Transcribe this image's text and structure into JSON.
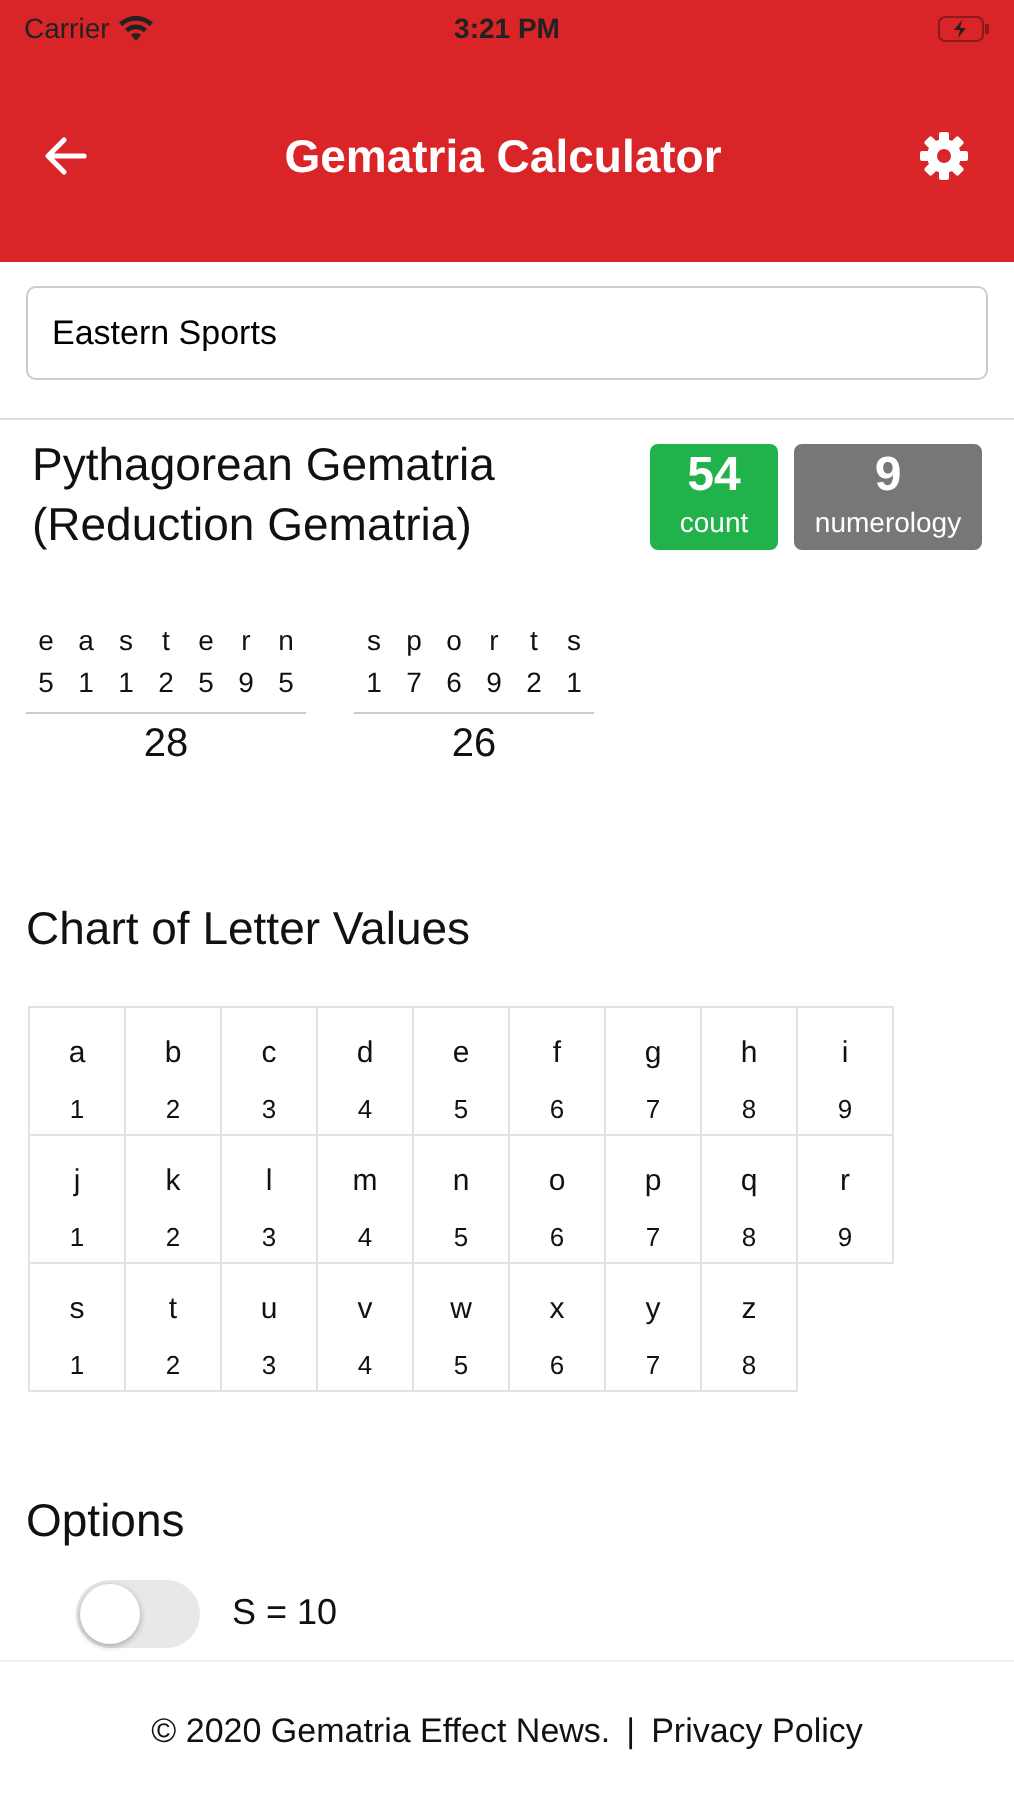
{
  "status_bar": {
    "carrier": "Carrier",
    "time": "3:21 PM",
    "battery_charging": true
  },
  "header": {
    "title": "Gematria Calculator"
  },
  "search": {
    "value": "Eastern Sports"
  },
  "result": {
    "title": "Pythagorean Gematria (Reduction Gematria)",
    "count": "54",
    "count_label": "count",
    "numerology": "9",
    "numerology_label": "numerology"
  },
  "words": [
    {
      "letters": [
        "e",
        "a",
        "s",
        "t",
        "e",
        "r",
        "n"
      ],
      "values": [
        "5",
        "1",
        "1",
        "2",
        "5",
        "9",
        "5"
      ],
      "total": "28"
    },
    {
      "letters": [
        "s",
        "p",
        "o",
        "r",
        "t",
        "s"
      ],
      "values": [
        "1",
        "7",
        "6",
        "9",
        "2",
        "1"
      ],
      "total": "26"
    }
  ],
  "chart": {
    "title": "Chart of Letter Values",
    "cells": [
      {
        "letter": "a",
        "value": "1"
      },
      {
        "letter": "b",
        "value": "2"
      },
      {
        "letter": "c",
        "value": "3"
      },
      {
        "letter": "d",
        "value": "4"
      },
      {
        "letter": "e",
        "value": "5"
      },
      {
        "letter": "f",
        "value": "6"
      },
      {
        "letter": "g",
        "value": "7"
      },
      {
        "letter": "h",
        "value": "8"
      },
      {
        "letter": "i",
        "value": "9"
      },
      {
        "letter": "j",
        "value": "1"
      },
      {
        "letter": "k",
        "value": "2"
      },
      {
        "letter": "l",
        "value": "3"
      },
      {
        "letter": "m",
        "value": "4"
      },
      {
        "letter": "n",
        "value": "5"
      },
      {
        "letter": "o",
        "value": "6"
      },
      {
        "letter": "p",
        "value": "7"
      },
      {
        "letter": "q",
        "value": "8"
      },
      {
        "letter": "r",
        "value": "9"
      },
      {
        "letter": "s",
        "value": "1"
      },
      {
        "letter": "t",
        "value": "2"
      },
      {
        "letter": "u",
        "value": "3"
      },
      {
        "letter": "v",
        "value": "4"
      },
      {
        "letter": "w",
        "value": "5"
      },
      {
        "letter": "x",
        "value": "6"
      },
      {
        "letter": "y",
        "value": "7"
      },
      {
        "letter": "z",
        "value": "8"
      }
    ]
  },
  "options": {
    "title": "Options",
    "items": [
      {
        "label": "S = 10",
        "on": false
      }
    ]
  },
  "footer": {
    "copyright": "© 2020 Gematria Effect News.",
    "separator": "|",
    "link": "Privacy Policy"
  }
}
